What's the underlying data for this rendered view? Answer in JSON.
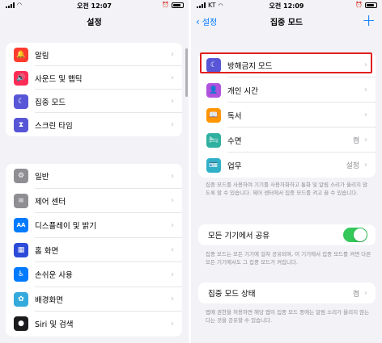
{
  "left": {
    "status": {
      "carrier": "",
      "time": "오전 12:07"
    },
    "nav_title": "설정",
    "group1": [
      {
        "label": "알림",
        "icon": "bell-icon",
        "color": "#ff3b30",
        "glyph": "🔔"
      },
      {
        "label": "사운드 및 햅틱",
        "icon": "speaker-icon",
        "color": "#ff2d55",
        "glyph": "🔊"
      },
      {
        "label": "집중 모드",
        "icon": "moon-icon",
        "color": "#5856d6",
        "glyph": "☾"
      },
      {
        "label": "스크린 타임",
        "icon": "hourglass-icon",
        "color": "#5856d6",
        "glyph": "⧗"
      }
    ],
    "group2": [
      {
        "label": "일반",
        "icon": "gear-icon",
        "color": "#8e8e93",
        "glyph": "⚙"
      },
      {
        "label": "제어 센터",
        "icon": "switches-icon",
        "color": "#8e8e93",
        "glyph": "≡"
      },
      {
        "label": "디스플레이 및 밝기",
        "icon": "text-size-icon",
        "color": "#007aff",
        "glyph": "AA"
      },
      {
        "label": "홈 화면",
        "icon": "home-grid-icon",
        "color": "#2c4bd8",
        "glyph": "▦"
      },
      {
        "label": "손쉬운 사용",
        "icon": "accessibility-icon",
        "color": "#007aff",
        "glyph": "♿"
      },
      {
        "label": "배경화면",
        "icon": "flower-icon",
        "color": "#34aadc",
        "glyph": "✿"
      },
      {
        "label": "Siri 및 검색",
        "icon": "siri-icon",
        "color": "#1c1c1e",
        "glyph": "●"
      }
    ]
  },
  "right": {
    "status": {
      "carrier": "KT",
      "time": "오전 12:09"
    },
    "nav_back": "설정",
    "nav_title": "집중 모드",
    "add_label": "+",
    "modes": [
      {
        "label": "방해금지 모드",
        "icon": "moon-icon",
        "color": "#5856d6",
        "glyph": "☾",
        "value": ""
      },
      {
        "label": "개인 시간",
        "icon": "person-icon",
        "color": "#af52de",
        "glyph": "👤",
        "value": ""
      },
      {
        "label": "독서",
        "icon": "book-icon",
        "color": "#ff9500",
        "glyph": "📖",
        "value": ""
      },
      {
        "label": "수면",
        "icon": "bed-icon",
        "color": "#30b0a0",
        "glyph": "🛏",
        "value": "켬"
      },
      {
        "label": "업무",
        "icon": "badge-icon",
        "color": "#30b0c7",
        "glyph": "🪪",
        "value": "설정"
      }
    ],
    "note1": "집중 모드를 사용하여 기기를 사용자화하고 통화 및 알림 소리가 울리지 않도록 할 수 있습니다. 제어 센터에서 집중 모드를 켜고 끌 수 있습니다.",
    "share_label": "모든 기기에서 공유",
    "note2": "집중 모드는 모든 기기에 걸쳐 공유되며, 이 기기에서 집중 모드를 켜면 다른 모든 기기에서도 그 집중 모드가 켜집니다.",
    "status_label": "집중 모드 상태",
    "status_value": "켬",
    "note3": "앱에 권한을 허용하면 해당 앱이 집중 모드 중에는 알림 소리가 울리지 않는다는 것을 공유할 수 있습니다."
  }
}
